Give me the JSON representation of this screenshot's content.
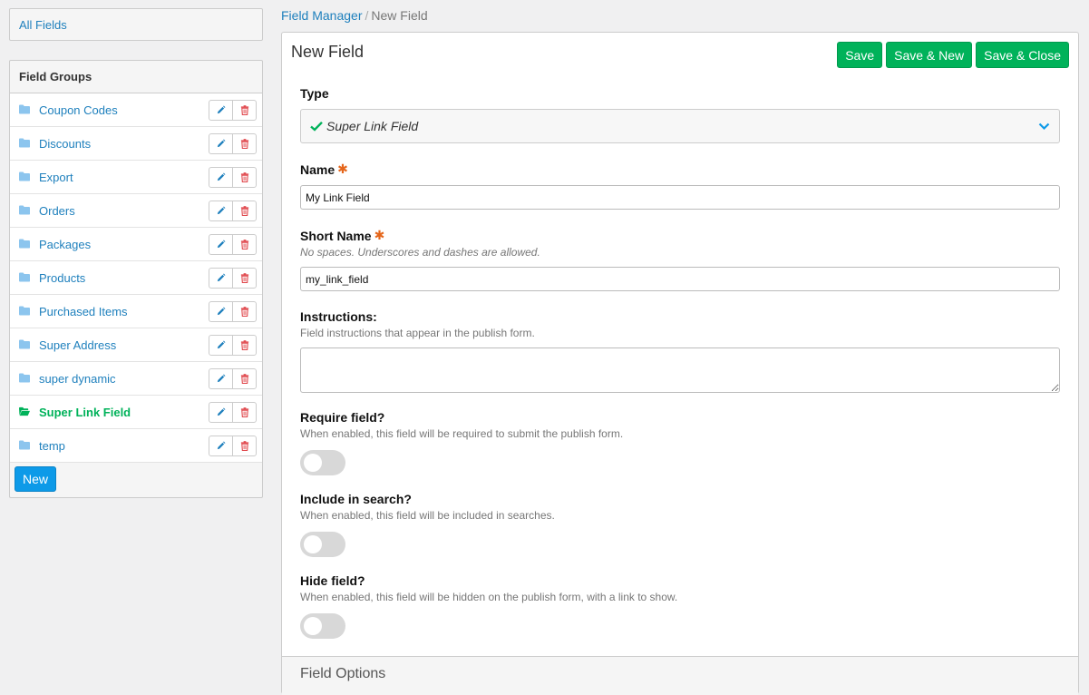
{
  "sidebar": {
    "all_fields": "All Fields",
    "groups_title": "Field Groups",
    "groups": [
      {
        "label": "Coupon Codes",
        "active": false
      },
      {
        "label": "Discounts",
        "active": false
      },
      {
        "label": "Export",
        "active": false
      },
      {
        "label": "Orders",
        "active": false
      },
      {
        "label": "Packages",
        "active": false
      },
      {
        "label": "Products",
        "active": false
      },
      {
        "label": "Purchased Items",
        "active": false
      },
      {
        "label": "Super Address",
        "active": false
      },
      {
        "label": "super dynamic",
        "active": false
      },
      {
        "label": "Super Link Field",
        "active": true
      },
      {
        "label": "temp",
        "active": false
      }
    ],
    "new_button": "New"
  },
  "breadcrumb": {
    "parent": "Field Manager",
    "separator": "/",
    "current": "New Field"
  },
  "panel": {
    "title": "New Field",
    "actions": {
      "save": "Save",
      "save_new": "Save & New",
      "save_close": "Save & Close"
    }
  },
  "form": {
    "type": {
      "label": "Type",
      "value": "Super Link Field"
    },
    "name": {
      "label": "Name",
      "required_mark": "✱",
      "value": "My Link Field"
    },
    "short_name": {
      "label": "Short Name",
      "required_mark": "✱",
      "help": "No spaces. Underscores and dashes are allowed.",
      "value": "my_link_field"
    },
    "instructions": {
      "label": "Instructions:",
      "help": "Field instructions that appear in the publish form.",
      "value": ""
    },
    "require": {
      "label": "Require field?",
      "help": "When enabled, this field will be required to submit the publish form.",
      "enabled": false
    },
    "search": {
      "label": "Include in search?",
      "help": "When enabled, this field will be included in searches.",
      "enabled": false
    },
    "hide": {
      "label": "Hide field?",
      "help": "When enabled, this field will be hidden on the publish form, with a link to show.",
      "enabled": false
    }
  },
  "options_section": "Field Options",
  "colors": {
    "link": "#1f80bd",
    "accent_green": "#00b25a",
    "primary_blue": "#0d9ae8",
    "required": "#e5661b"
  }
}
